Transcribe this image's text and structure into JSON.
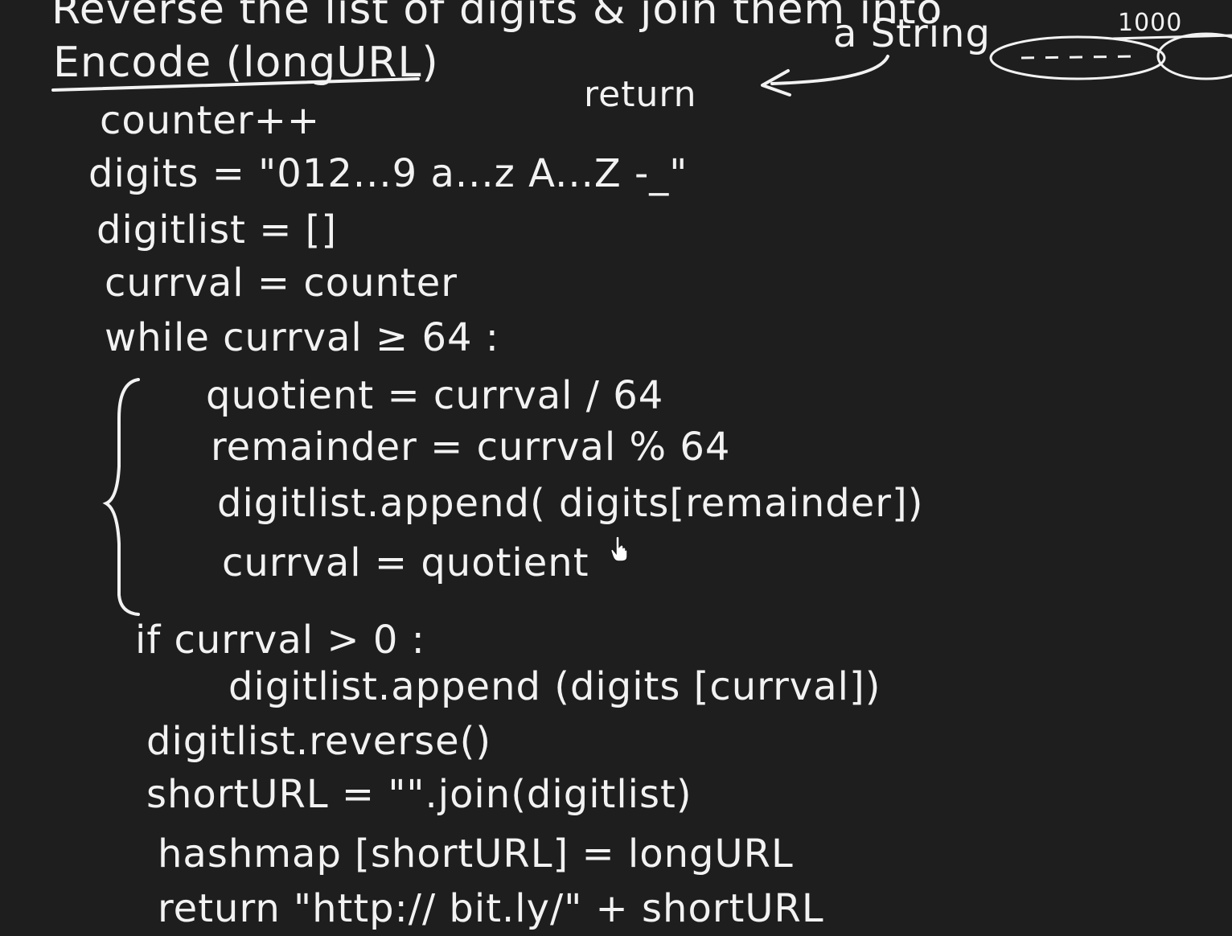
{
  "board": {
    "background_color": "#1f1e1e",
    "ink_color": "#f2f2f2"
  },
  "notes": {
    "top_line": "Reverse the list of digits & join them into",
    "string_note": "a String",
    "number_note": "1000",
    "return_note": "return"
  },
  "code": {
    "title": "Encode (longURL)",
    "lines": [
      "counter++",
      "digits = \"012...9 a...z A...Z -_\"",
      "digitlist = []",
      "currval = counter",
      "while currval ≥ 64 :",
      "quotient = currval / 64",
      "remainder = currval % 64",
      "digitlist.append( digits[remainder])",
      "currval = quotient",
      "if currval > 0 :",
      "digitlist.append (digits [currval])",
      "digitlist.reverse()",
      "shortURL = \"\".join(digitlist)",
      "hashmap [shortURL] = longURL",
      "return \"http:// bit.ly/\" + shortURL"
    ]
  },
  "icons": {
    "cursor": "hand-pointer-icon",
    "loop_brace": "curly-brace-icon",
    "arrow": "curved-arrow-icon"
  }
}
